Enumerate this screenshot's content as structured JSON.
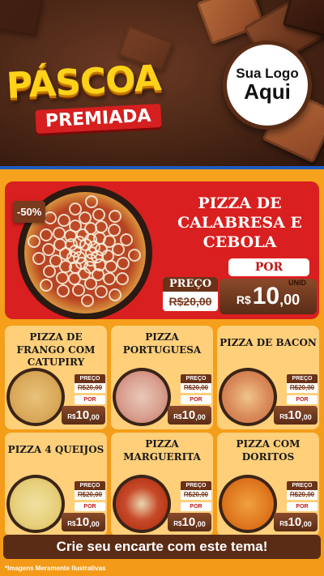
{
  "header": {
    "title": "PÁSCOA",
    "subtitle": "PREMIADA",
    "logo_line1": "Sua Logo",
    "logo_line2": "Aqui"
  },
  "featured": {
    "discount": "-50%",
    "name": "PIZZA DE CALABRESA E CEBOLA",
    "price_label": "PREÇO",
    "old_price": "R$20,00",
    "por_label": "POR",
    "unit_label": "UNID",
    "currency": "R$",
    "price_int": "10",
    "price_cents": ",00"
  },
  "products": [
    {
      "name": "PIZZA DE FRANGO COM CATUPIRY",
      "price_label": "PREÇO",
      "old_price": "R$20,00",
      "por_label": "POR",
      "currency": "R$",
      "price_int": "10",
      "price_cents": ",00"
    },
    {
      "name": "PIZZA PORTUGUESA",
      "price_label": "PREÇO",
      "old_price": "R$20,00",
      "por_label": "POR",
      "currency": "R$",
      "price_int": "10",
      "price_cents": ",00"
    },
    {
      "name": "PIZZA DE BACON",
      "price_label": "PREÇO",
      "old_price": "R$20,00",
      "por_label": "POR",
      "currency": "R$",
      "price_int": "10",
      "price_cents": ",00"
    },
    {
      "name": "PIZZA 4 QUEIJOS",
      "price_label": "PREÇO",
      "old_price": "R$20,00",
      "por_label": "POR",
      "currency": "R$",
      "price_int": "10",
      "price_cents": ",00"
    },
    {
      "name": "PIZZA MARGUERITA",
      "price_label": "PREÇO",
      "old_price": "R$20,00",
      "por_label": "POR",
      "currency": "R$",
      "price_int": "10",
      "price_cents": ",00"
    },
    {
      "name": "PIZZA COM DORITOS",
      "price_label": "PREÇO",
      "old_price": "R$20,00",
      "por_label": "POR",
      "currency": "R$",
      "price_int": "10",
      "price_cents": ",00"
    }
  ],
  "footer": {
    "cta": "Crie seu encarte com este tema!",
    "disclaimer": "*Imagens Meramente Ilustrativas"
  },
  "colors": {
    "brand_red": "#d91f1f",
    "chocolate": "#5a2c16",
    "orange_bg": "#f7a21c",
    "card_bg": "#ffcf7a",
    "title_yellow": "#ffd21a"
  }
}
